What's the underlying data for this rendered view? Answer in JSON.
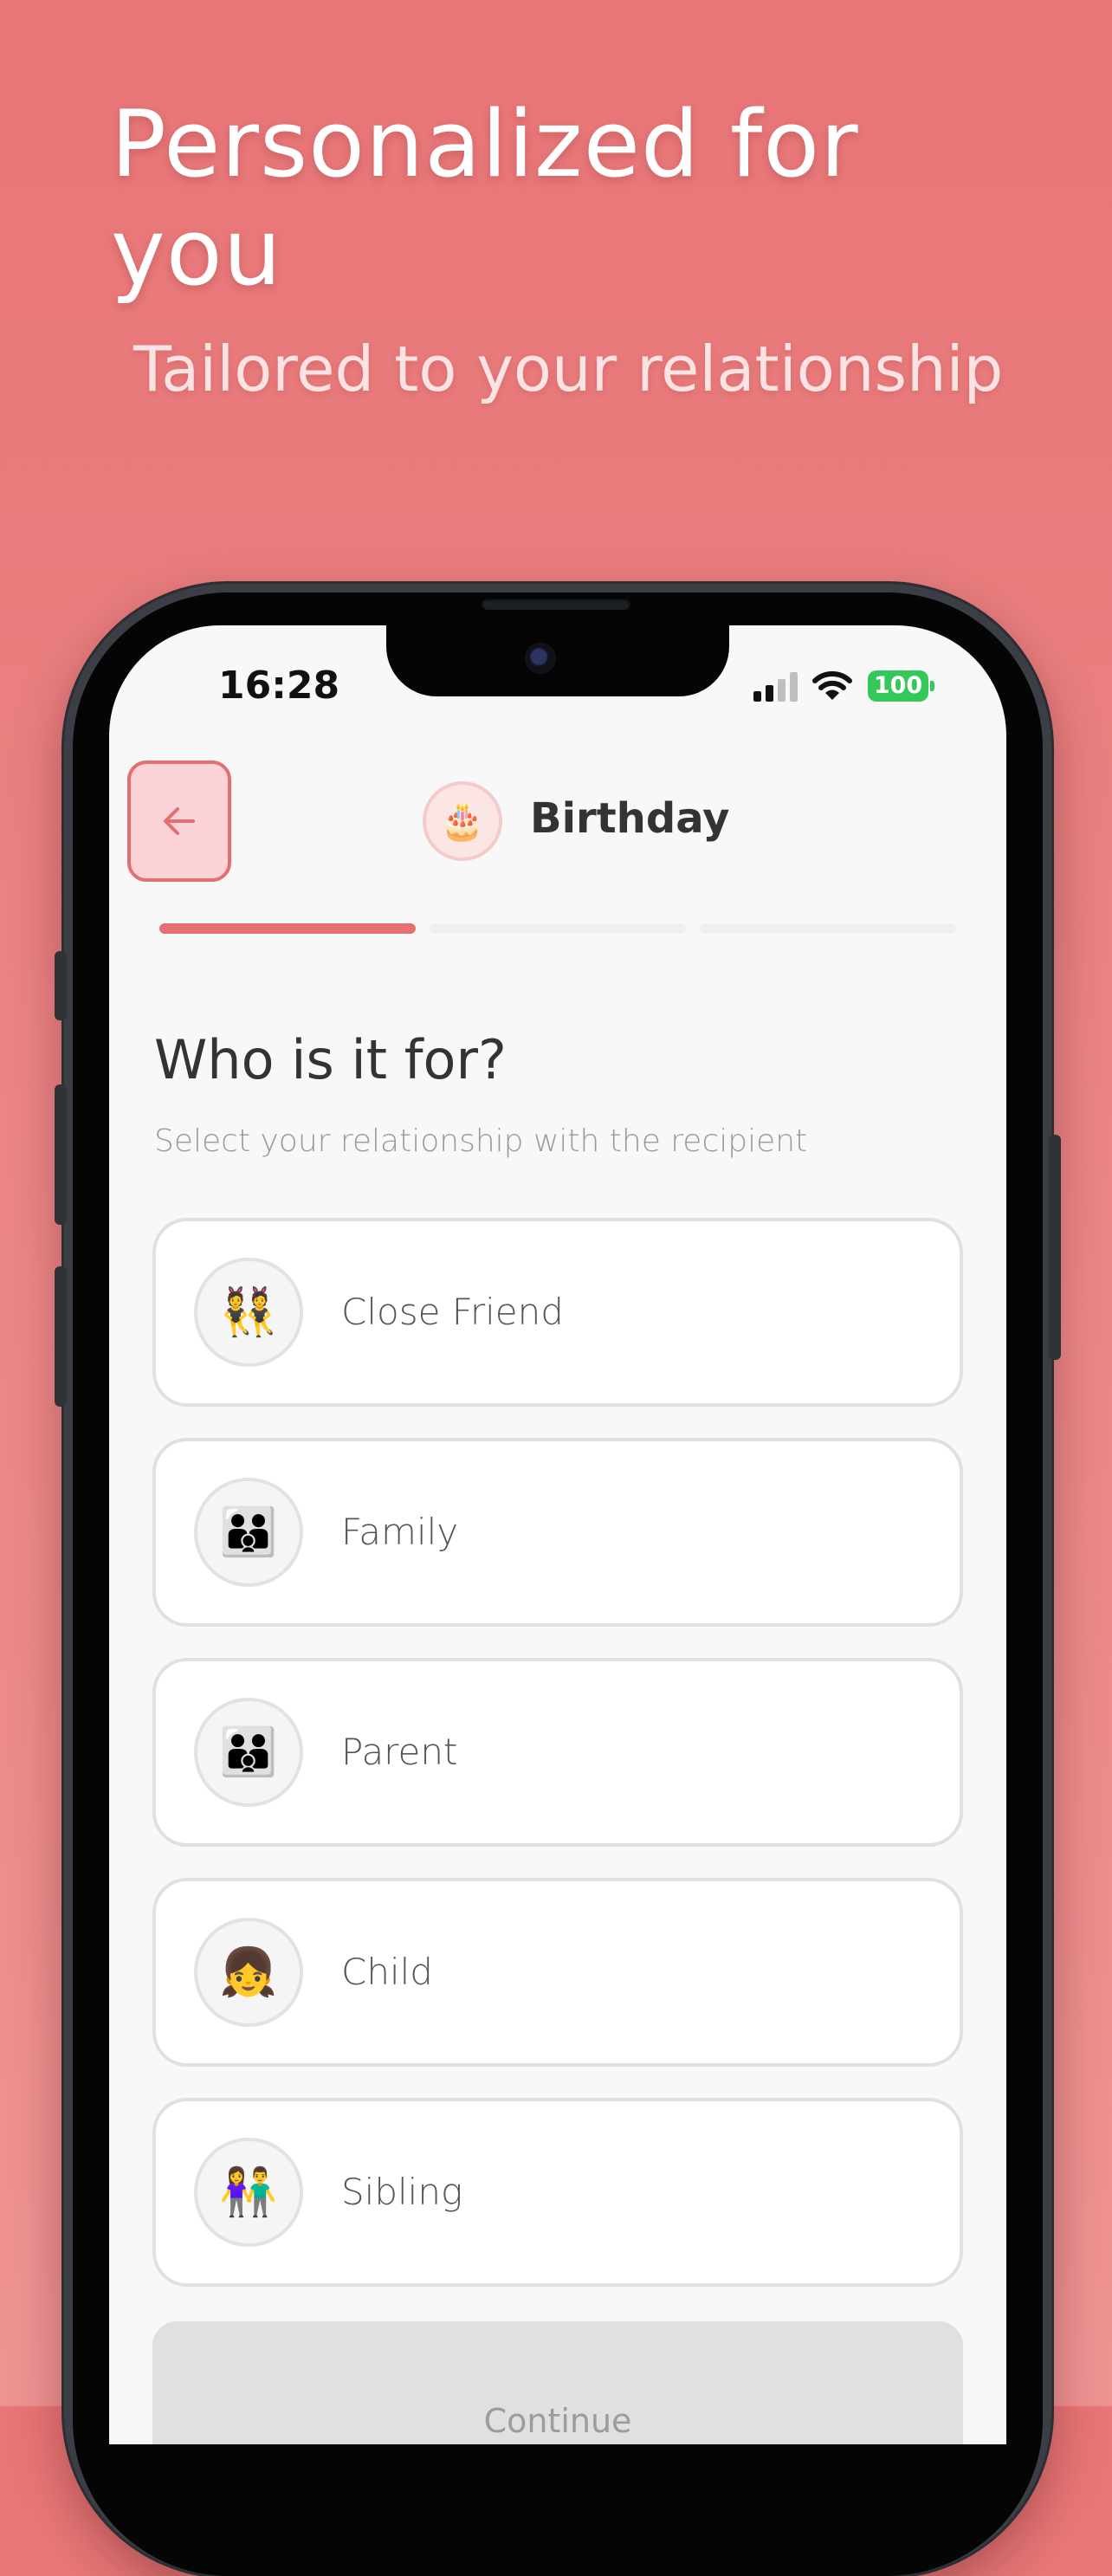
{
  "promo": {
    "title": "Personalized for you",
    "subtitle": "Tailored to your relationship"
  },
  "status_bar": {
    "time": "16:28",
    "battery": "100",
    "signal_icon": "cellular-signal-icon",
    "wifi_icon": "wifi-icon",
    "battery_color": "#34c759"
  },
  "header": {
    "back_icon": "arrow-left-icon",
    "emoji": "🎂",
    "title": "Birthday"
  },
  "progress": {
    "steps_total": 3,
    "current_step": 1
  },
  "question": {
    "title": "Who is it for?",
    "subtitle": "Select your relationship with the recipient"
  },
  "options": [
    {
      "emoji": "👯",
      "label": "Close Friend"
    },
    {
      "emoji": "👪",
      "label": "Family"
    },
    {
      "emoji": "👪",
      "label": "Parent"
    },
    {
      "emoji": "👧",
      "label": "Child"
    },
    {
      "emoji": "👫",
      "label": "Sibling"
    }
  ],
  "footer": {
    "continue_label": "Continue"
  },
  "colors": {
    "accent": "#e76f73",
    "accent_light": "#fbd3d6",
    "background_gradient_top": "#e87577",
    "background_gradient_bottom": "#ef9393",
    "card_border": "#e0e0e0",
    "disabled_button": "#e0e0e0"
  }
}
